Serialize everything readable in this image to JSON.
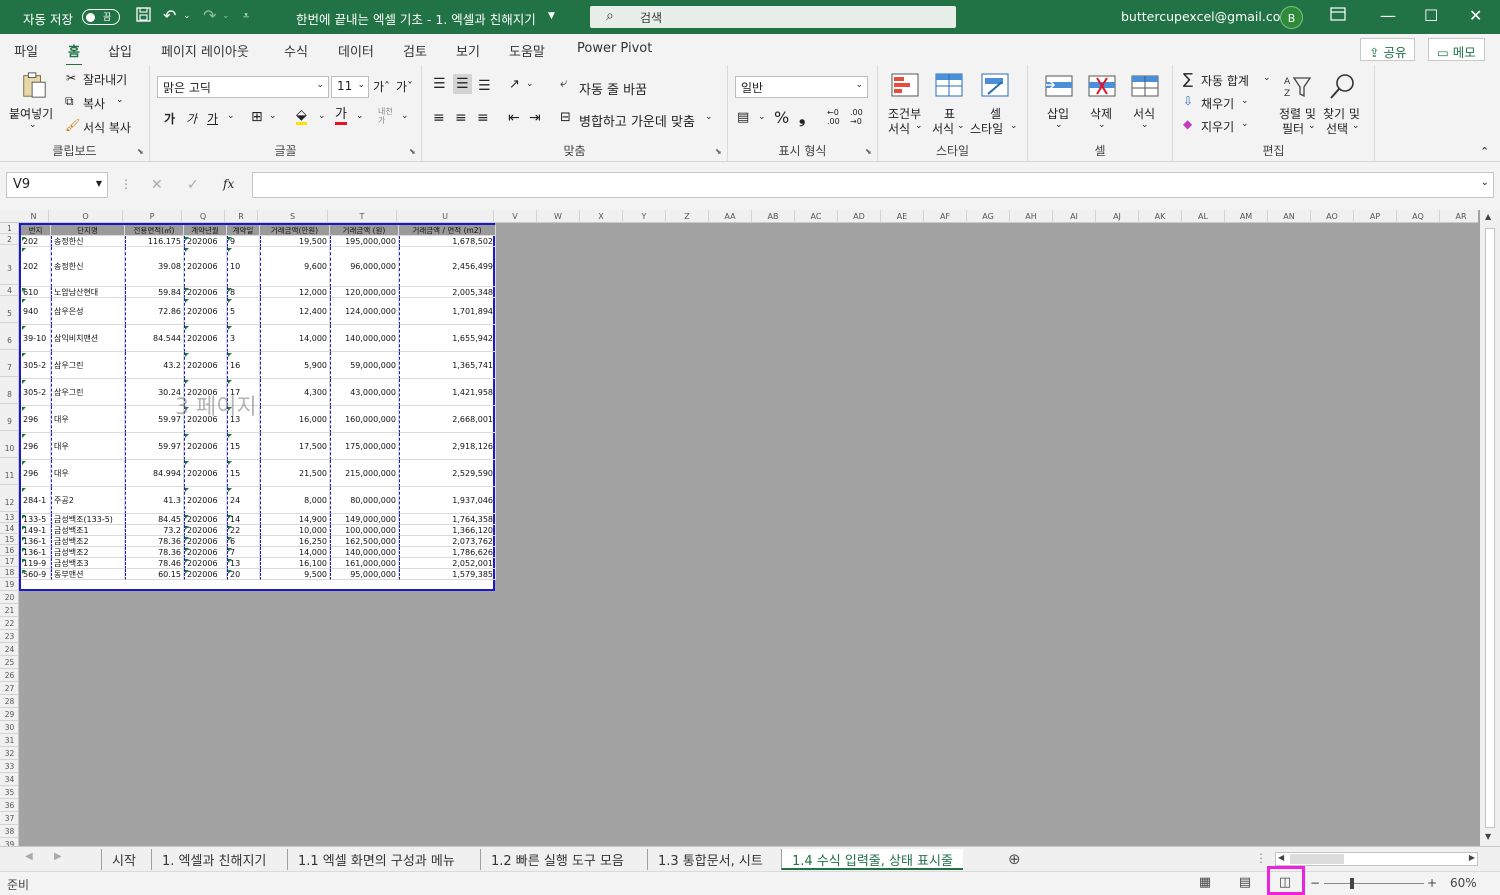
{
  "titlebar": {
    "autosave_label": "자동 저장",
    "autosave_state": "끔",
    "doc_title": "한번에 끝내는 엑셀 기초 - 1. 엑셀과 친해지기",
    "search_placeholder": "검색",
    "email": "buttercupexcel@gmail.com",
    "avatar": "B"
  },
  "menu": {
    "tabs": [
      "파일",
      "홈",
      "삽입",
      "페이지 레이아웃",
      "수식",
      "데이터",
      "검토",
      "보기",
      "도움말",
      "Power Pivot"
    ],
    "active": "홈",
    "share": "공유",
    "memo": "메모"
  },
  "ribbon": {
    "clipboard": {
      "label": "클립보드",
      "paste": "붙여넣기",
      "cut": "잘라내기",
      "copy": "복사",
      "format_painter": "서식 복사"
    },
    "font": {
      "label": "글꼴",
      "name": "맑은 고딕",
      "size": "11"
    },
    "align": {
      "label": "맞춤",
      "wrap": "자동 줄 바꿈",
      "merge": "병합하고 가운데 맞춤"
    },
    "number": {
      "label": "표시 형식",
      "format": "일반"
    },
    "styles": {
      "label": "스타일",
      "cond": "조건부",
      "cond2": "서식",
      "table": "표",
      "table2": "서식",
      "cell": "셀",
      "cell2": "스타일"
    },
    "cells": {
      "label": "셀",
      "insert": "삽입",
      "delete": "삭제",
      "format": "서식"
    },
    "edit": {
      "label": "편집",
      "autosum": "자동 합계",
      "fill": "채우기",
      "clear": "지우기",
      "sort": "정렬 및",
      "sort2": "필터",
      "find": "찾기 및",
      "find2": "선택"
    }
  },
  "formula_bar": {
    "name_box": "V9",
    "fx": "fx",
    "value": ""
  },
  "columns": [
    "N",
    "O",
    "P",
    "Q",
    "R",
    "S",
    "T",
    "U",
    "V",
    "W",
    "X",
    "Y",
    "Z",
    "AA",
    "AB",
    "AC",
    "AD",
    "AE",
    "AF",
    "AG",
    "AH",
    "AI",
    "AJ",
    "AK",
    "AL",
    "AM",
    "AN",
    "AO",
    "AP",
    "AQ",
    "AR"
  ],
  "table": {
    "headers": [
      "번지",
      "단지명",
      "전용면적(㎡)",
      "계약년월",
      "계약일",
      "거래금액(만원)",
      "거래금액 (원)",
      "거래금액 / 면적 (m2)"
    ],
    "rows": [
      [
        "202",
        "송정한신",
        "116.175",
        "202006",
        "9",
        "19,500",
        "195,000,000",
        "1,678,502"
      ],
      [
        "202",
        "송정한신",
        "39.08",
        "202006",
        "10",
        "9,600",
        "96,000,000",
        "2,456,499"
      ],
      [
        "610",
        "노암남산현대",
        "59.84",
        "202006",
        "8",
        "12,000",
        "120,000,000",
        "2,005,348"
      ],
      [
        "940",
        "삼우은성",
        "72.86",
        "202006",
        "5",
        "12,400",
        "124,000,000",
        "1,701,894"
      ],
      [
        "39-10",
        "삼익비치맨션",
        "84.544",
        "202006",
        "3",
        "14,000",
        "140,000,000",
        "1,655,942"
      ],
      [
        "305-2",
        "삼우그린",
        "43.2",
        "202006",
        "16",
        "5,900",
        "59,000,000",
        "1,365,741"
      ],
      [
        "305-2",
        "삼우그린",
        "30.24",
        "202006",
        "17",
        "4,300",
        "43,000,000",
        "1,421,958"
      ],
      [
        "296",
        "대우",
        "59.97",
        "202006",
        "13",
        "16,000",
        "160,000,000",
        "2,668,001"
      ],
      [
        "296",
        "대우",
        "59.97",
        "202006",
        "15",
        "17,500",
        "175,000,000",
        "2,918,126"
      ],
      [
        "296",
        "대우",
        "84.994",
        "202006",
        "15",
        "21,500",
        "215,000,000",
        "2,529,590"
      ],
      [
        "284-1",
        "주공2",
        "41.3",
        "202006",
        "24",
        "8,000",
        "80,000,000",
        "1,937,046"
      ],
      [
        "133-5",
        "금성백조(133-5)",
        "84.45",
        "202006",
        "14",
        "14,900",
        "149,000,000",
        "1,764,358"
      ],
      [
        "149-1",
        "금성백조1",
        "73.2",
        "202006",
        "22",
        "10,000",
        "100,000,000",
        "1,366,120"
      ],
      [
        "136-1",
        "금성백조2",
        "78.36",
        "202006",
        "6",
        "16,250",
        "162,500,000",
        "2,073,762"
      ],
      [
        "136-1",
        "금성백조2",
        "78.36",
        "202006",
        "7",
        "14,000",
        "140,000,000",
        "1,786,626"
      ],
      [
        "119-9",
        "금성백조3",
        "78.46",
        "202006",
        "13",
        "16,100",
        "161,000,000",
        "2,052,001"
      ],
      [
        "560-9",
        "동부맨션",
        "60.15",
        "202006",
        "20",
        "9,500",
        "95,000,000",
        "1,579,385"
      ]
    ]
  },
  "watermark": "3 페이지",
  "sheets": [
    "시작",
    "1. 엑셀과 친해지기",
    "1.1 엑셀 화면의 구성과 메뉴",
    "1.2 빠른 실행 도구 모음",
    "1.3 통합문서, 시트",
    "1.4 수식 입력줄, 상태 표시줄"
  ],
  "active_sheet": "1.4 수식 입력줄, 상태 표시줄",
  "status": {
    "ready": "준비",
    "zoom": "60%"
  }
}
